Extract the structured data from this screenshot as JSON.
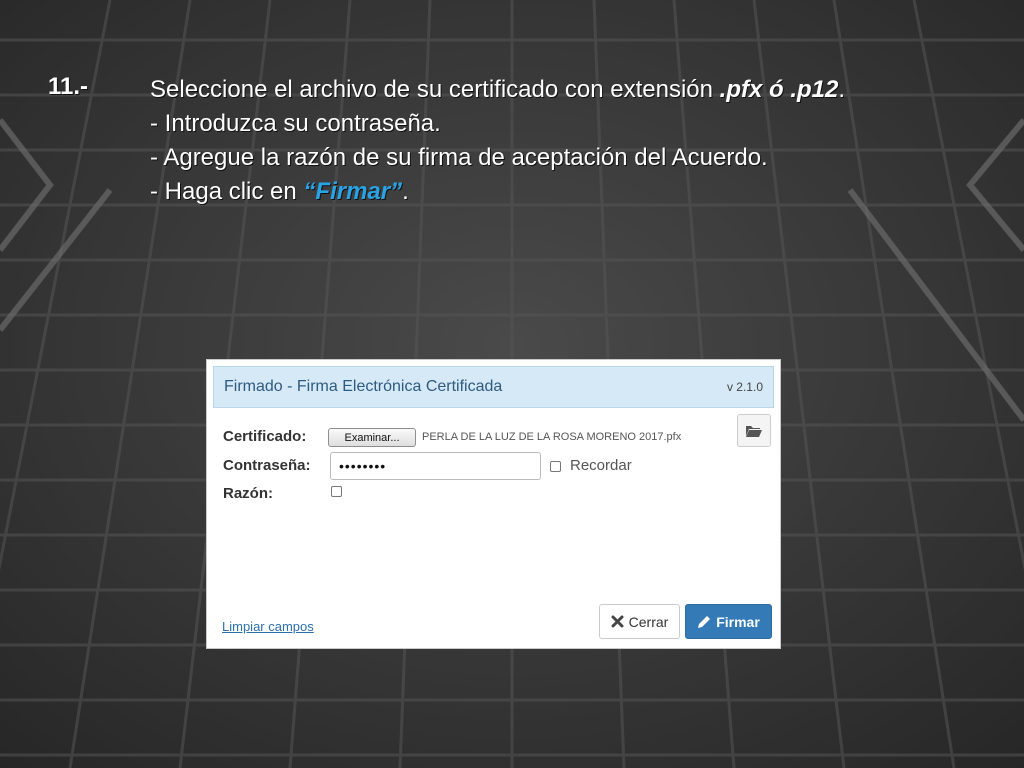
{
  "slide": {
    "step_number": "11.-",
    "line1_prefix": "Seleccione el archivo de su certificado con extensión ",
    "line1_ext": ".pfx ó .p12",
    "line1_suffix": ".",
    "line2": "- Introduzca su contraseña.",
    "line3": "- Agregue la razón de su firma de aceptación del Acuerdo.",
    "line4_prefix": "- Haga clic en ",
    "line4_emphasis": "“Firmar”",
    "line4_suffix": ".",
    "emphasis_color": "#2aa3e6"
  },
  "dialog": {
    "title": "Firmado - Firma Electrónica Certificada",
    "version": "v 2.1.0",
    "certificate_label": "Certificado:",
    "browse_label": "Examinar...",
    "file_name": "PERLA DE LA LUZ DE LA ROSA MORENO 2017.pfx",
    "password_label": "Contraseña:",
    "password_value": "••••••••",
    "remember_label": "Recordar",
    "remember_checked": false,
    "reason_label": "Razón:",
    "reason_checked": false,
    "clear_link": "Limpiar campos",
    "close_label": "Cerrar",
    "sign_label": "Firmar",
    "folder_icon": "folder-open-icon",
    "close_icon": "times-icon",
    "sign_icon": "pencil-icon",
    "header_color": "#d6e9f6",
    "primary_color": "#337ab7"
  }
}
